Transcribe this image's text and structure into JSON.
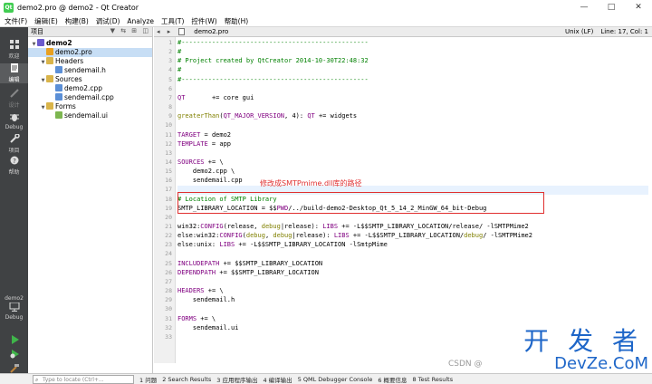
{
  "window": {
    "title": "demo2.pro @ demo2 - Qt Creator",
    "buttons": [
      "—",
      "□",
      "✕"
    ]
  },
  "menu": [
    "文件(F)",
    "编辑(E)",
    "构建(B)",
    "调试(D)",
    "Analyze",
    "工具(T)",
    "控件(W)",
    "帮助(H)"
  ],
  "modes": [
    {
      "label": "欢迎",
      "icon": "grid-icon"
    },
    {
      "label": "编辑",
      "icon": "edit-icon"
    },
    {
      "label": "设计",
      "icon": "pencil-icon"
    },
    {
      "label": "Debug",
      "icon": "bug-icon"
    },
    {
      "label": "项目",
      "icon": "wrench-icon"
    },
    {
      "label": "帮助",
      "icon": "help-icon"
    }
  ],
  "kit": {
    "name": "demo2",
    "mode": "Debug"
  },
  "project_pane": {
    "title": "项目",
    "tools": "▼ ⇆ ⊞ ◫"
  },
  "tree": [
    {
      "label": "demo2",
      "level": 0,
      "kind": "project"
    },
    {
      "label": "demo2.pro",
      "level": 1,
      "kind": "profile"
    },
    {
      "label": "Headers",
      "level": 1,
      "kind": "folder"
    },
    {
      "label": "sendemail.h",
      "level": 2,
      "kind": "header"
    },
    {
      "label": "Sources",
      "level": 1,
      "kind": "folder"
    },
    {
      "label": "demo2.cpp",
      "level": 2,
      "kind": "source"
    },
    {
      "label": "sendemail.cpp",
      "level": 2,
      "kind": "source"
    },
    {
      "label": "Forms",
      "level": 1,
      "kind": "folder"
    },
    {
      "label": "sendemail.ui",
      "level": 2,
      "kind": "form"
    }
  ],
  "editor": {
    "nav": "◂ ▸",
    "tab": "demo2.pro",
    "encoding": "Unix (LF)",
    "position": "Line: 17, Col: 1",
    "current_line": 17
  },
  "code": [
    [
      {
        "t": "#-------------------------------------------------",
        "c": "cmt"
      }
    ],
    [
      {
        "t": "#",
        "c": "cmt"
      }
    ],
    [
      {
        "t": "# Project created by QtCreator 2014-10-30T22:48:32",
        "c": "cmt"
      }
    ],
    [
      {
        "t": "#",
        "c": "cmt"
      }
    ],
    [
      {
        "t": "#-------------------------------------------------",
        "c": "cmt"
      }
    ],
    [],
    [
      {
        "t": "QT",
        "c": "var"
      },
      {
        "t": "       += core gui",
        "c": ""
      }
    ],
    [],
    [
      {
        "t": "greaterThan",
        "c": "fn"
      },
      {
        "t": "(",
        "c": ""
      },
      {
        "t": "QT_MAJOR_VERSION",
        "c": "var"
      },
      {
        "t": ", 4): ",
        "c": ""
      },
      {
        "t": "QT",
        "c": "var"
      },
      {
        "t": " += widgets",
        "c": ""
      }
    ],
    [],
    [
      {
        "t": "TARGET",
        "c": "var"
      },
      {
        "t": " = demo2",
        "c": ""
      }
    ],
    [
      {
        "t": "TEMPLATE",
        "c": "var"
      },
      {
        "t": " = app",
        "c": ""
      }
    ],
    [],
    [
      {
        "t": "SOURCES",
        "c": "var"
      },
      {
        "t": " += \\",
        "c": ""
      }
    ],
    [
      {
        "t": "    demo2.cpp \\",
        "c": ""
      }
    ],
    [
      {
        "t": "    sendemail.cpp",
        "c": ""
      }
    ],
    [],
    [
      {
        "t": "# Location of SMTP Library",
        "c": "cmt"
      }
    ],
    [
      {
        "t": "SMTP_LIBRARY_LOCATION = $$",
        "c": ""
      },
      {
        "t": "PWD",
        "c": "var"
      },
      {
        "t": "/../build-demo2-Desktop_Qt_5_14_2_MinGW_64_bit-Debug",
        "c": ""
      }
    ],
    [],
    [
      {
        "t": "win32:",
        "c": ""
      },
      {
        "t": "CONFIG",
        "c": "var"
      },
      {
        "t": "(release, ",
        "c": ""
      },
      {
        "t": "debug",
        "c": "fn"
      },
      {
        "t": "|release): ",
        "c": ""
      },
      {
        "t": "LIBS",
        "c": "var"
      },
      {
        "t": " += -L$$SMTP_LIBRARY_LOCATION/release/ -lSMTPMime2",
        "c": ""
      }
    ],
    [
      {
        "t": "else:win32:",
        "c": ""
      },
      {
        "t": "CONFIG",
        "c": "var"
      },
      {
        "t": "(",
        "c": ""
      },
      {
        "t": "debug",
        "c": "fn"
      },
      {
        "t": ", ",
        "c": ""
      },
      {
        "t": "debug",
        "c": "fn"
      },
      {
        "t": "|release): ",
        "c": ""
      },
      {
        "t": "LIBS",
        "c": "var"
      },
      {
        "t": " += -L$$SMTP_LIBRARY_LOCATION/",
        "c": ""
      },
      {
        "t": "debug",
        "c": "fn"
      },
      {
        "t": "/ -lSMTPMime2",
        "c": ""
      }
    ],
    [
      {
        "t": "else:unix: ",
        "c": ""
      },
      {
        "t": "LIBS",
        "c": "var"
      },
      {
        "t": " += -L$$SMTP_LIBRARY_LOCATION -lSmtpMime",
        "c": ""
      }
    ],
    [],
    [
      {
        "t": "INCLUDEPATH",
        "c": "var"
      },
      {
        "t": " += $$SMTP_LIBRARY_LOCATION",
        "c": ""
      }
    ],
    [
      {
        "t": "DEPENDPATH",
        "c": "var"
      },
      {
        "t": " += $$SMTP_LIBRARY_LOCATION",
        "c": ""
      }
    ],
    [],
    [
      {
        "t": "HEADERS",
        "c": "var"
      },
      {
        "t": " += \\",
        "c": ""
      }
    ],
    [
      {
        "t": "    sendemail.h",
        "c": ""
      }
    ],
    [],
    [
      {
        "t": "FORMS",
        "c": "var"
      },
      {
        "t": " += \\",
        "c": ""
      }
    ],
    [
      {
        "t": "    sendemail.ui",
        "c": ""
      }
    ],
    []
  ],
  "annotation": "修改成SMTPmime.dll库的路径",
  "locator": {
    "placeholder": "Type to locate (Ctrl+..."
  },
  "output_tabs": [
    "1 问题",
    "2 Search Results",
    "3 应用程序输出",
    "4 编译输出",
    "5 QML Debugger Console",
    "6 概要信息",
    "8 Test Results"
  ],
  "watermark": {
    "main": "开 发 者",
    "url": "DevZe.CoM",
    "csdn": "CSDN @"
  }
}
